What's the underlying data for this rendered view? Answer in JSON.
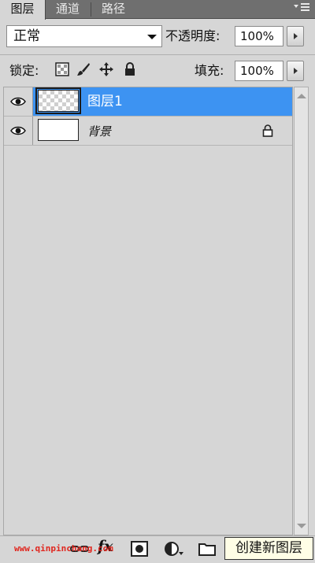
{
  "tabs": [
    {
      "label": "图层",
      "active": true
    },
    {
      "label": "通道",
      "active": false
    },
    {
      "label": "路径",
      "active": false
    }
  ],
  "panel_menu_icon": "panel-menu-icon",
  "blend_mode": {
    "value": "正常"
  },
  "opacity": {
    "label": "不透明度:",
    "value": "100%"
  },
  "lock": {
    "label": "锁定:",
    "icons": [
      "lock-transparent-pixels-icon",
      "lock-image-pixels-icon",
      "lock-position-icon",
      "lock-all-icon"
    ]
  },
  "fill": {
    "label": "填充:",
    "value": "100%"
  },
  "layers": [
    {
      "name": "图层1",
      "selected": true,
      "visible": true,
      "transparent_thumb": true,
      "locked": false
    },
    {
      "name": "背景",
      "selected": false,
      "visible": true,
      "transparent_thumb": false,
      "locked": true
    }
  ],
  "colors": {
    "selection": "#3d93f2",
    "panel_bg": "#d6d6d6",
    "tab_bar": "#6f6f6f",
    "watermark": "#e0261e",
    "tooltip_bg": "#fffee6"
  },
  "toolbar": {
    "icons": [
      "link-layers-icon",
      "fx-icon",
      "add-mask-icon",
      "adjustment-layer-icon",
      "new-group-icon"
    ],
    "fx_label": "fx",
    "watermark": "www.qinpinchang.com",
    "tooltip": "创建新图层"
  }
}
